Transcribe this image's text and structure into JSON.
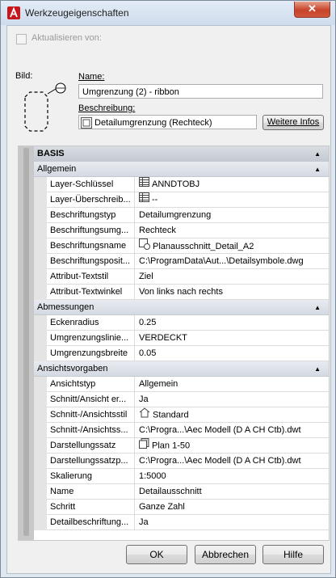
{
  "window": {
    "title": "Werkzeugeigenschaften",
    "close_glyph": "✕"
  },
  "update": {
    "label": "Aktualisieren von:"
  },
  "image": {
    "label": "Bild:"
  },
  "name": {
    "label": "Name:",
    "value": "Umgrenzung (2) - ribbon"
  },
  "description": {
    "label": "Beschreibung:",
    "value": "Detailumgrenzung (Rechteck)",
    "more_button": "Weitere Infos"
  },
  "grid": {
    "top_section": "BASIS",
    "sections": [
      {
        "title": "Allgemein",
        "rows": [
          {
            "name": "Layer-Schlüssel",
            "value": "ANNDTOBJ",
            "icon": "layer-table-icon"
          },
          {
            "name": "Layer-Überschreib...",
            "value": "--",
            "icon": "layer-table-icon"
          },
          {
            "name": "Beschriftungstyp",
            "value": "Detailumgrenzung",
            "icon": ""
          },
          {
            "name": "Beschriftungsumg...",
            "value": "Rechteck",
            "icon": ""
          },
          {
            "name": "Beschriftungsname",
            "value": "Planausschnitt_Detail_A2",
            "icon": "block-icon"
          },
          {
            "name": "Beschriftungsposit...",
            "value": "C:\\ProgramData\\Aut...\\Detailsymbole.dwg",
            "icon": ""
          },
          {
            "name": "Attribut-Textstil",
            "value": "Ziel",
            "icon": ""
          },
          {
            "name": "Attribut-Textwinkel",
            "value": "Von links nach rechts",
            "icon": ""
          }
        ]
      },
      {
        "title": "Abmessungen",
        "rows": [
          {
            "name": "Eckenradius",
            "value": "0.25",
            "icon": ""
          },
          {
            "name": "Umgrenzungslinie...",
            "value": "VERDECKT",
            "icon": ""
          },
          {
            "name": "Umgrenzungsbreite",
            "value": "0.05",
            "icon": ""
          }
        ]
      },
      {
        "title": "Ansichtsvorgaben",
        "rows": [
          {
            "name": "Ansichtstyp",
            "value": "Allgemein",
            "icon": ""
          },
          {
            "name": "Schnitt/Ansicht er...",
            "value": "Ja",
            "icon": ""
          },
          {
            "name": "Schnitt-/Ansichtsstil",
            "value": "Standard",
            "icon": "house-icon"
          },
          {
            "name": "Schnitt-/Ansichtss...",
            "value": "C:\\Progra...\\Aec Modell (D A CH Ctb).dwt",
            "icon": ""
          },
          {
            "name": "Darstellungssatz",
            "value": "Plan 1-50",
            "icon": "display-set-icon"
          },
          {
            "name": "Darstellungssatzp...",
            "value": "C:\\Progra...\\Aec Modell (D A CH Ctb).dwt",
            "icon": ""
          },
          {
            "name": "Skalierung",
            "value": "1:5000",
            "icon": ""
          },
          {
            "name": "Name",
            "value": "Detailausschnitt",
            "icon": ""
          },
          {
            "name": "Schritt",
            "value": "Ganze Zahl",
            "icon": ""
          },
          {
            "name": "Detailbeschriftung...",
            "value": "Ja",
            "icon": ""
          }
        ]
      }
    ]
  },
  "buttons": {
    "ok": "OK",
    "cancel": "Abbrechen",
    "help": "Hilfe"
  }
}
